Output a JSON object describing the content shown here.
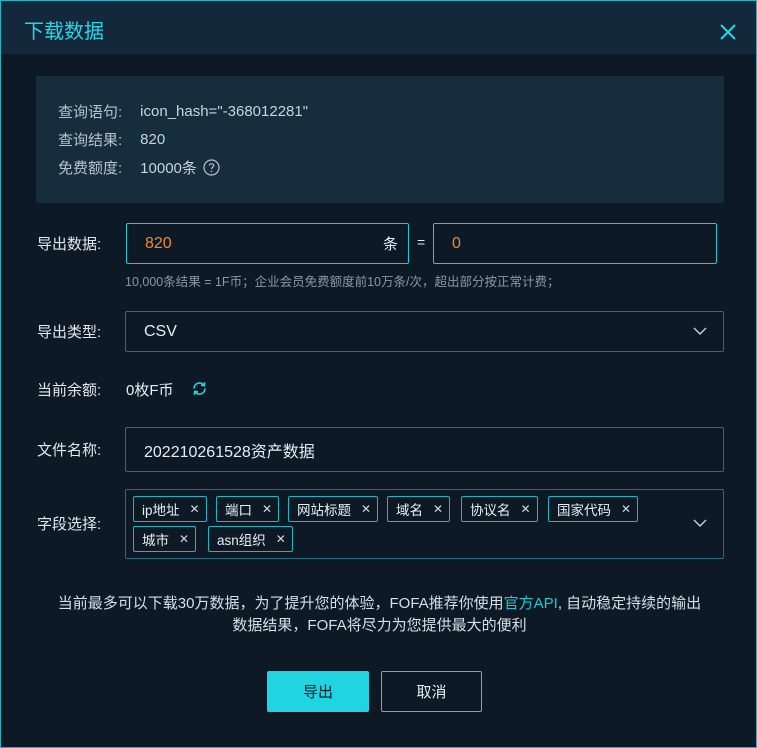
{
  "dialog": {
    "title": "下载数据"
  },
  "info": {
    "query_label": "查询语句:",
    "query_value": "icon_hash=\"-368012281\"",
    "result_label": "查询结果:",
    "result_value": "820",
    "quota_label": "免费额度:",
    "quota_value": "10000条"
  },
  "export_count": {
    "label": "导出数据:",
    "value": "820",
    "unit": "条",
    "equals": "=",
    "cost": "0",
    "hint": "10,000条结果 = 1F币；企业会员免费额度前10万条/次，超出部分按正常计费；"
  },
  "export_type": {
    "label": "导出类型:",
    "value": "CSV"
  },
  "balance": {
    "label": "当前余额:",
    "value": "0枚F币"
  },
  "filename": {
    "label": "文件名称:",
    "value": "202210261528资产数据"
  },
  "fields": {
    "label": "字段选择:",
    "tags": [
      "ip地址",
      "端口",
      "网站标题",
      "域名",
      "协议名",
      "国家代码",
      "城市",
      "asn组织"
    ]
  },
  "notice": {
    "line1_before": "当前最多可以下载30万数据，为了提升您的体验，FOFA推荐你使用",
    "link": "官方API",
    "line1_after": ", 自动稳定持续的输出",
    "line2": "数据结果，FOFA将尽力为您提供最大的便利"
  },
  "buttons": {
    "export": "导出",
    "cancel": "取消"
  },
  "colors": {
    "accent": "#20d4e0",
    "orange": "#f08a24",
    "background": "#0d1a26"
  }
}
